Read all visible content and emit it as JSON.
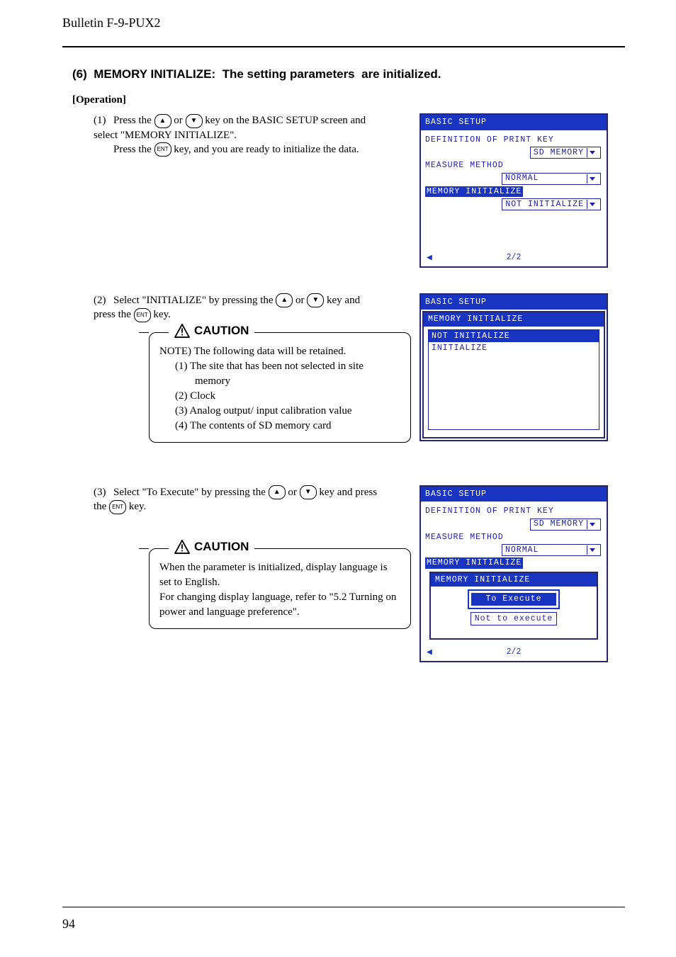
{
  "header": {
    "bulletin": "Bulletin F-9-PUX2"
  },
  "section": {
    "num": "(6)",
    "title_a": "MEMORY INITIALIZE:",
    "title_b": "The setting parameters",
    "title_c": "are initialized."
  },
  "operation_label": "[Operation]",
  "keys": {
    "up": "▲",
    "down": "▼",
    "ent": "ENT"
  },
  "steps": {
    "s1": {
      "num": "(1)",
      "l1a": "Press the ",
      "l1b": " or ",
      "l1c": " key on the BASIC SETUP screen and select \"MEMORY INITIALIZE\".",
      "l2a": "Press the ",
      "l2b": " key, and you are ready to initialize the data."
    },
    "s2": {
      "num": "(2)",
      "l1a": "Select \"INITIALIZE\" by pressing the ",
      "l1b": " or ",
      "l1c": " key and press the ",
      "l1d": " key."
    },
    "s3": {
      "num": "(3)",
      "l1a": "Select \"To Execute\" by pressing the ",
      "l1b": " or ",
      "l1c": " key and press the ",
      "l1d": " key."
    }
  },
  "caution1": {
    "label": "CAUTION",
    "note": "NOTE) The following data will be retained.",
    "items": {
      "i1": "(1)  The site that has been not selected in site memory",
      "i2": "(2)  Clock",
      "i3": "(3)  Analog output/ input calibration value",
      "i4": "(4)  The contents of SD memory card"
    }
  },
  "caution2": {
    "label": "CAUTION",
    "p1": "When the parameter is initialized, display language is set to English.",
    "p2": "For changing display language, refer to \"5.2 Turning on power and language preference\"."
  },
  "screen1": {
    "title": "BASIC SETUP",
    "r1": "DEFINITION OF PRINT KEY",
    "v1": "SD MEMORY",
    "r2": "MEASURE METHOD",
    "v2": "NORMAL",
    "r3": "MEMORY INITIALIZE",
    "v3": "NOT INITIALIZE",
    "page": "2/2",
    "arrow": "◀"
  },
  "screen2": {
    "title": "BASIC SETUP",
    "popup_title": "MEMORY INITIALIZE",
    "opt_sel": "NOT INITIALIZE",
    "opt2": "INITIALIZE"
  },
  "screen3": {
    "title": "BASIC SETUP",
    "r1": "DEFINITION OF PRINT KEY",
    "v1": "SD MEMORY",
    "r2": "MEASURE METHOD",
    "v2": "NORMAL",
    "r3": "MEMORY INITIALIZE",
    "modal_title": "MEMORY INITIALIZE",
    "btn1": "To Execute",
    "btn2": "Not to execute",
    "page": "2/2",
    "arrow": "◀"
  },
  "footer": {
    "page_num": "94"
  }
}
